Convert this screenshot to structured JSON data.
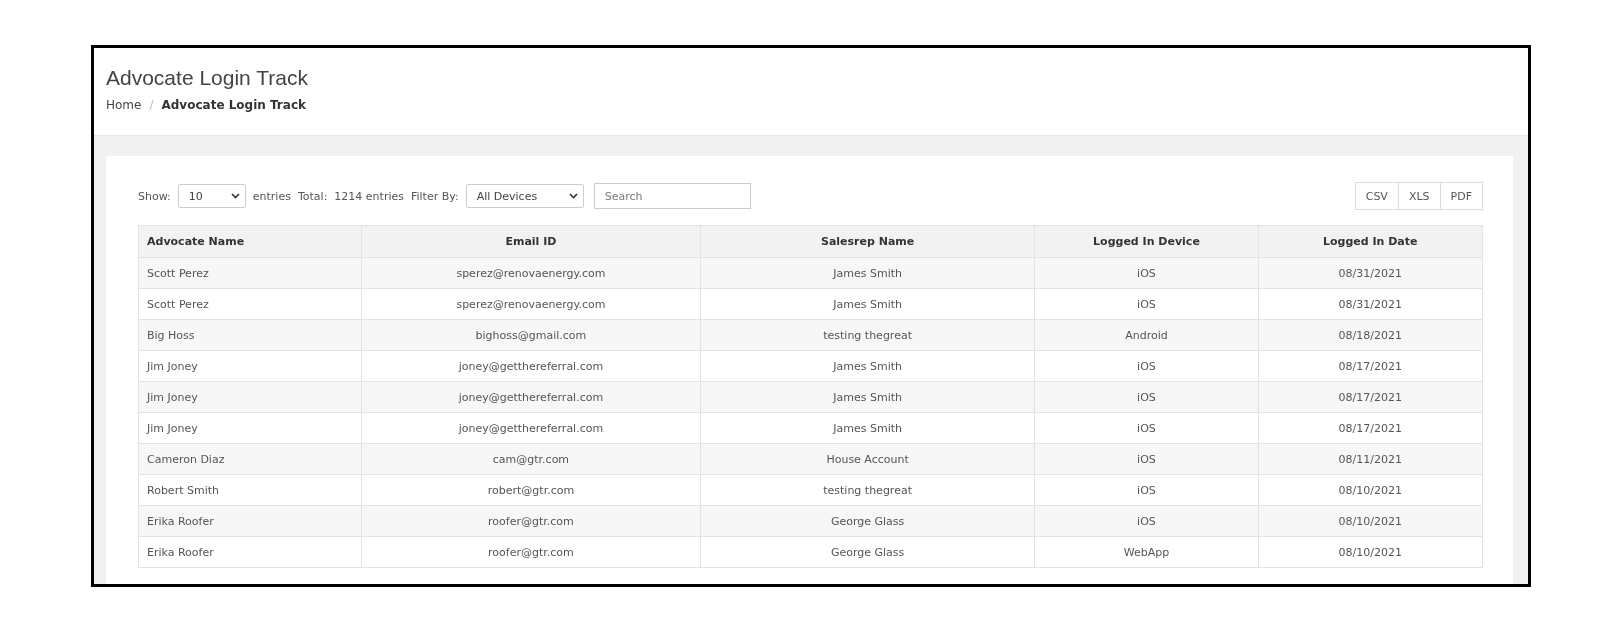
{
  "page": {
    "title": "Advocate Login Track",
    "breadcrumb_separator": "/",
    "breadcrumb": [
      {
        "label": "Home",
        "current": false
      },
      {
        "label": "Advocate Login Track",
        "current": true
      }
    ]
  },
  "toolbar": {
    "show_label": "Show:",
    "page_size": "10",
    "entries_label": "entries",
    "total_label": "Total:",
    "total_value": "1214 entries",
    "filter_label": "Filter By:",
    "filter_value": "All Devices",
    "search": {
      "placeholder": "Search"
    },
    "export_buttons": [
      "CSV",
      "XLS",
      "PDF"
    ]
  },
  "table": {
    "columns": [
      "Advocate Name",
      "Email ID",
      "Salesrep Name",
      "Logged In Device",
      "Logged In Date"
    ],
    "rows": [
      [
        "Scott Perez",
        "sperez@renovaenergy.com",
        "James Smith",
        "iOS",
        "08/31/2021"
      ],
      [
        "Scott Perez",
        "sperez@renovaenergy.com",
        "James Smith",
        "iOS",
        "08/31/2021"
      ],
      [
        "Big Hoss",
        "bighoss@gmail.com",
        "testing thegreat",
        "Android",
        "08/18/2021"
      ],
      [
        "Jim Joney",
        "joney@getthereferral.com",
        "James Smith",
        "iOS",
        "08/17/2021"
      ],
      [
        "Jim Joney",
        "joney@getthereferral.com",
        "James Smith",
        "iOS",
        "08/17/2021"
      ],
      [
        "Jim Joney",
        "joney@getthereferral.com",
        "James Smith",
        "iOS",
        "08/17/2021"
      ],
      [
        "Cameron Diaz",
        "cam@gtr.com",
        "House Account",
        "iOS",
        "08/11/2021"
      ],
      [
        "Robert Smith",
        "robert@gtr.com",
        "testing thegreat",
        "iOS",
        "08/10/2021"
      ],
      [
        "Erika Roofer",
        "roofer@gtr.com",
        "George Glass",
        "iOS",
        "08/10/2021"
      ],
      [
        "Erika Roofer",
        "roofer@gtr.com",
        "George Glass",
        "WebApp",
        "08/10/2021"
      ]
    ]
  }
}
